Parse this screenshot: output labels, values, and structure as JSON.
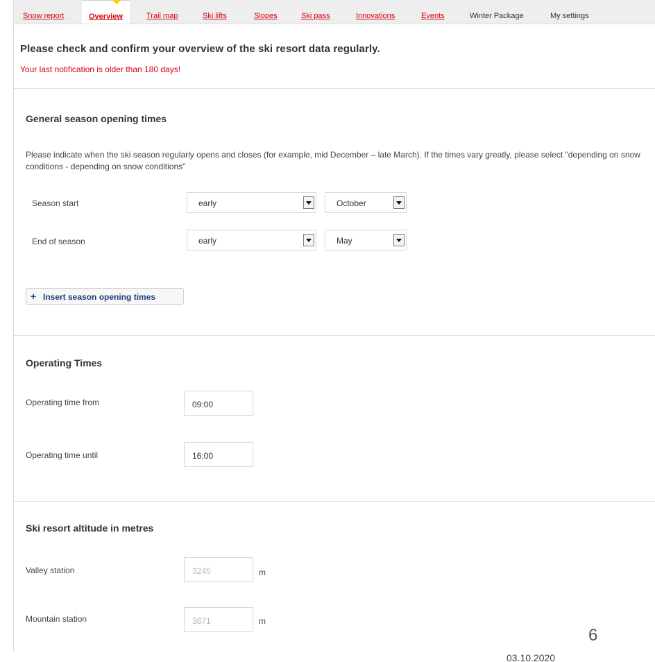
{
  "nav": {
    "tabs": [
      {
        "label": "Snow report"
      },
      {
        "label": "Overview"
      },
      {
        "label": "Trail map"
      },
      {
        "label": "Ski lifts"
      },
      {
        "label": "Slopes"
      },
      {
        "label": "Ski pass"
      },
      {
        "label": "Innovations"
      },
      {
        "label": "Events"
      },
      {
        "label": "Winter Package"
      },
      {
        "label": "My settings"
      }
    ],
    "active_index": 1,
    "accent_color": "#d7000f",
    "marker_color": "#ffcc00"
  },
  "notice": {
    "title": "Please check and confirm your overview of the ski resort data regularly.",
    "warning": "Your last notification is older than 180 days!"
  },
  "season": {
    "title": "General season opening times",
    "help": "Please indicate when the ski season regularly opens and closes (for example, mid December – late March). If the times vary greatly, please select \"depending on snow conditions - depending on snow conditions\"",
    "start": {
      "label": "Season start",
      "period": "early",
      "month": "October"
    },
    "end": {
      "label": "End of season",
      "period": "early",
      "month": "May"
    },
    "add_button": {
      "icon": "plus-icon",
      "label": "Insert season opening times"
    }
  },
  "operating": {
    "title": "Operating Times",
    "from": {
      "label": "Operating time from",
      "value": "09:00"
    },
    "until": {
      "label": "Operating time until",
      "value": "16:00"
    }
  },
  "altitude": {
    "title": "Ski resort altitude in metres",
    "valley": {
      "label": "Valley station",
      "value": "3245",
      "unit": "m"
    },
    "mountain": {
      "label": "Mountain station",
      "value": "3871",
      "unit": "m"
    }
  },
  "slide": {
    "number": "6",
    "date": "03.10.2020"
  }
}
